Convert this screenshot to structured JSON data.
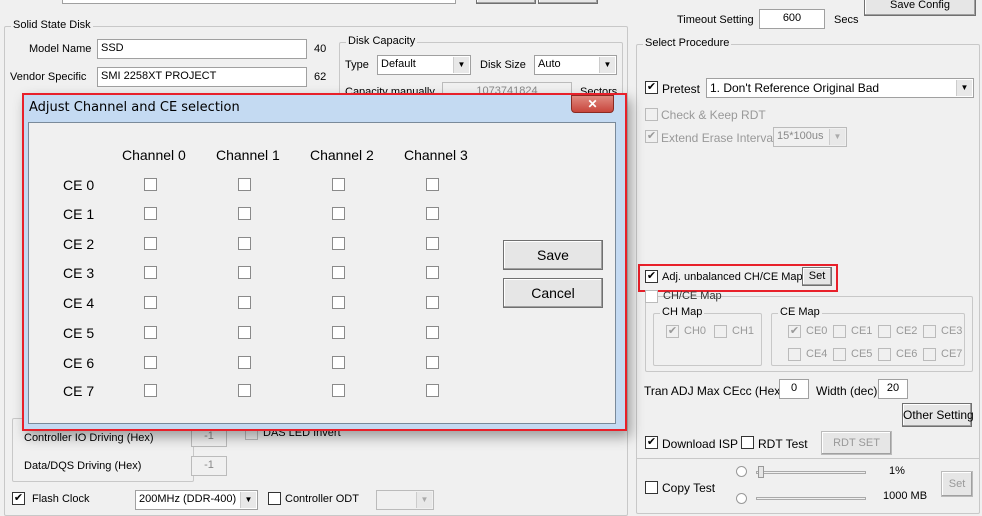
{
  "ssd": {
    "title": "Solid State Disk",
    "model_label": "Model Name",
    "model_value": "SSD",
    "model_len": "40",
    "vendor_label": "Vendor Specific",
    "vendor_value": "SMI 2258XT PROJECT",
    "vendor_len": "62",
    "cap": {
      "title": "Disk Capacity",
      "type_label": "Type",
      "type_value": "Default",
      "size_label": "Disk Size",
      "size_value": "Auto",
      "manual_label": "Capacity manually",
      "manual_value": "1073741824",
      "unit": "Sectors"
    },
    "ctrl_io_label": "Controller IO Driving (Hex)",
    "ctrl_io_value": "-1",
    "dqs_label": "Data/DQS Driving (Hex)",
    "dqs_value": "-1",
    "das_led": "DAS LED Invert",
    "flash_clock_label": "Flash Clock",
    "flash_clock_value": "200MHz (DDR-400)",
    "flash_clock_checked": true,
    "odt_label": "Controller ODT"
  },
  "top": {
    "save_config": "Save Config",
    "timeout_label": "Timeout Setting",
    "timeout_value": "600",
    "timeout_unit": "Secs"
  },
  "proc": {
    "title": "Select Procedure",
    "pretest_label": "Pretest",
    "pretest_value": "1. Don't Reference Original Bad",
    "check_keep": "Check & Keep RDT",
    "extend_erase": "Extend Erase Interval",
    "extend_value": "15*100us",
    "adj_label": "Adj. unbalanced CH/CE Map",
    "set": "Set",
    "chce_map": "CH/CE Map",
    "ch_map": "CH Map",
    "ce_map": "CE Map",
    "ch": [
      "CH0",
      "CH1"
    ],
    "ce": [
      "CE0",
      "CE1",
      "CE2",
      "CE3",
      "CE4",
      "CE5",
      "CE6",
      "CE7"
    ],
    "tran_label": "Tran ADJ Max CEcc (Hex)",
    "tran_value": "0",
    "width_label": "Width (dec)",
    "width_value": "20",
    "other": "Other Setting",
    "download_isp": "Download ISP",
    "rdt_test": "RDT Test",
    "rdt_set": "RDT SET",
    "copy_test": "Copy Test",
    "pct": "1%",
    "mb": "1000 MB",
    "copy_set": "Set"
  },
  "dialog": {
    "title": "Adjust Channel and CE selection",
    "channels": [
      "Channel 0",
      "Channel 1",
      "Channel 2",
      "Channel 3"
    ],
    "ces": [
      "CE 0",
      "CE 1",
      "CE 2",
      "CE 3",
      "CE 4",
      "CE 5",
      "CE 6",
      "CE 7"
    ],
    "save": "Save",
    "cancel": "Cancel"
  },
  "colors": {
    "highlight": "#e8202a",
    "titlebar": "#c4daf2",
    "close": "#c8453c"
  }
}
